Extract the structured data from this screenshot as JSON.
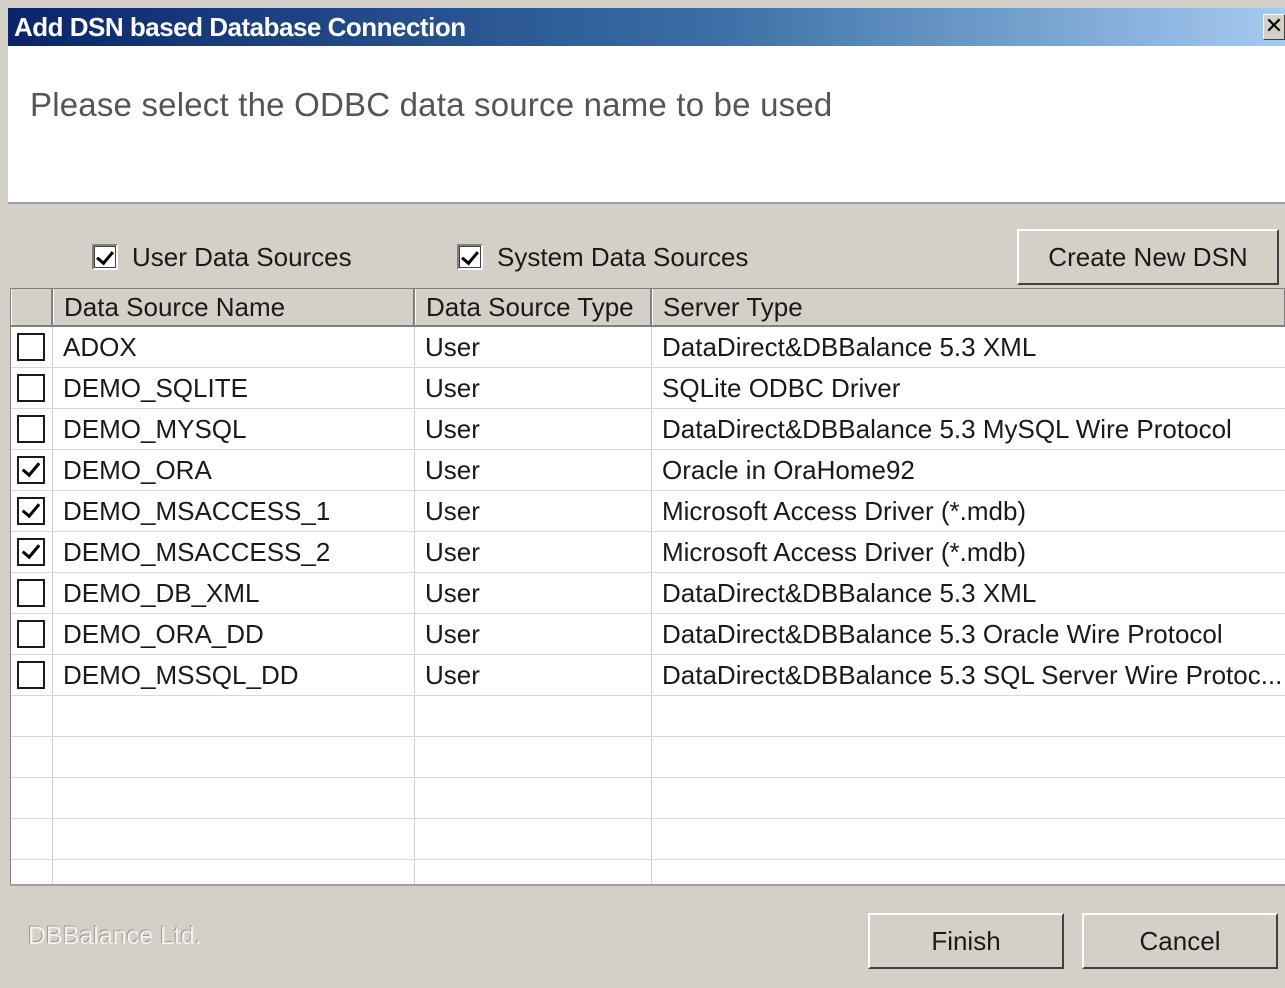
{
  "window": {
    "title": "Add DSN based Database Connection",
    "close_glyph": "✕",
    "title_gradient": [
      "#0a246a",
      "#3a6ea5",
      "#a6caf0"
    ]
  },
  "header": {
    "prompt": "Please select the ODBC data source name to be used"
  },
  "filters": {
    "user": {
      "label": "User Data Sources",
      "checked": true
    },
    "system": {
      "label": "System Data Sources",
      "checked": true
    }
  },
  "toolbar": {
    "create_label": "Create New DSN"
  },
  "table": {
    "columns": [
      "",
      "Data Source Name",
      "Data Source Type",
      "Server Type"
    ],
    "rows": [
      {
        "selected": false,
        "name": "ADOX",
        "type": "User",
        "server": "DataDirect&DBBalance 5.3 XML"
      },
      {
        "selected": false,
        "name": "DEMO_SQLITE",
        "type": "User",
        "server": "SQLite ODBC Driver"
      },
      {
        "selected": false,
        "name": "DEMO_MYSQL",
        "type": "User",
        "server": "DataDirect&DBBalance 5.3 MySQL Wire Protocol"
      },
      {
        "selected": true,
        "name": "DEMO_ORA",
        "type": "User",
        "server": "Oracle in OraHome92"
      },
      {
        "selected": true,
        "name": "DEMO_MSACCESS_1",
        "type": "User",
        "server": "Microsoft Access Driver (*.mdb)"
      },
      {
        "selected": true,
        "name": "DEMO_MSACCESS_2",
        "type": "User",
        "server": "Microsoft Access Driver (*.mdb)"
      },
      {
        "selected": false,
        "name": "DEMO_DB_XML",
        "type": "User",
        "server": "DataDirect&DBBalance 5.3 XML"
      },
      {
        "selected": false,
        "name": "DEMO_ORA_DD",
        "type": "User",
        "server": "DataDirect&DBBalance 5.3 Oracle Wire Protocol"
      },
      {
        "selected": false,
        "name": "DEMO_MSSQL_DD",
        "type": "User",
        "server": "DataDirect&DBBalance 5.3 SQL Server Wire Protoc..."
      }
    ],
    "empty_rows": 5
  },
  "footer": {
    "brand": "DBBalance Ltd.",
    "finish_label": "Finish",
    "cancel_label": "Cancel"
  }
}
